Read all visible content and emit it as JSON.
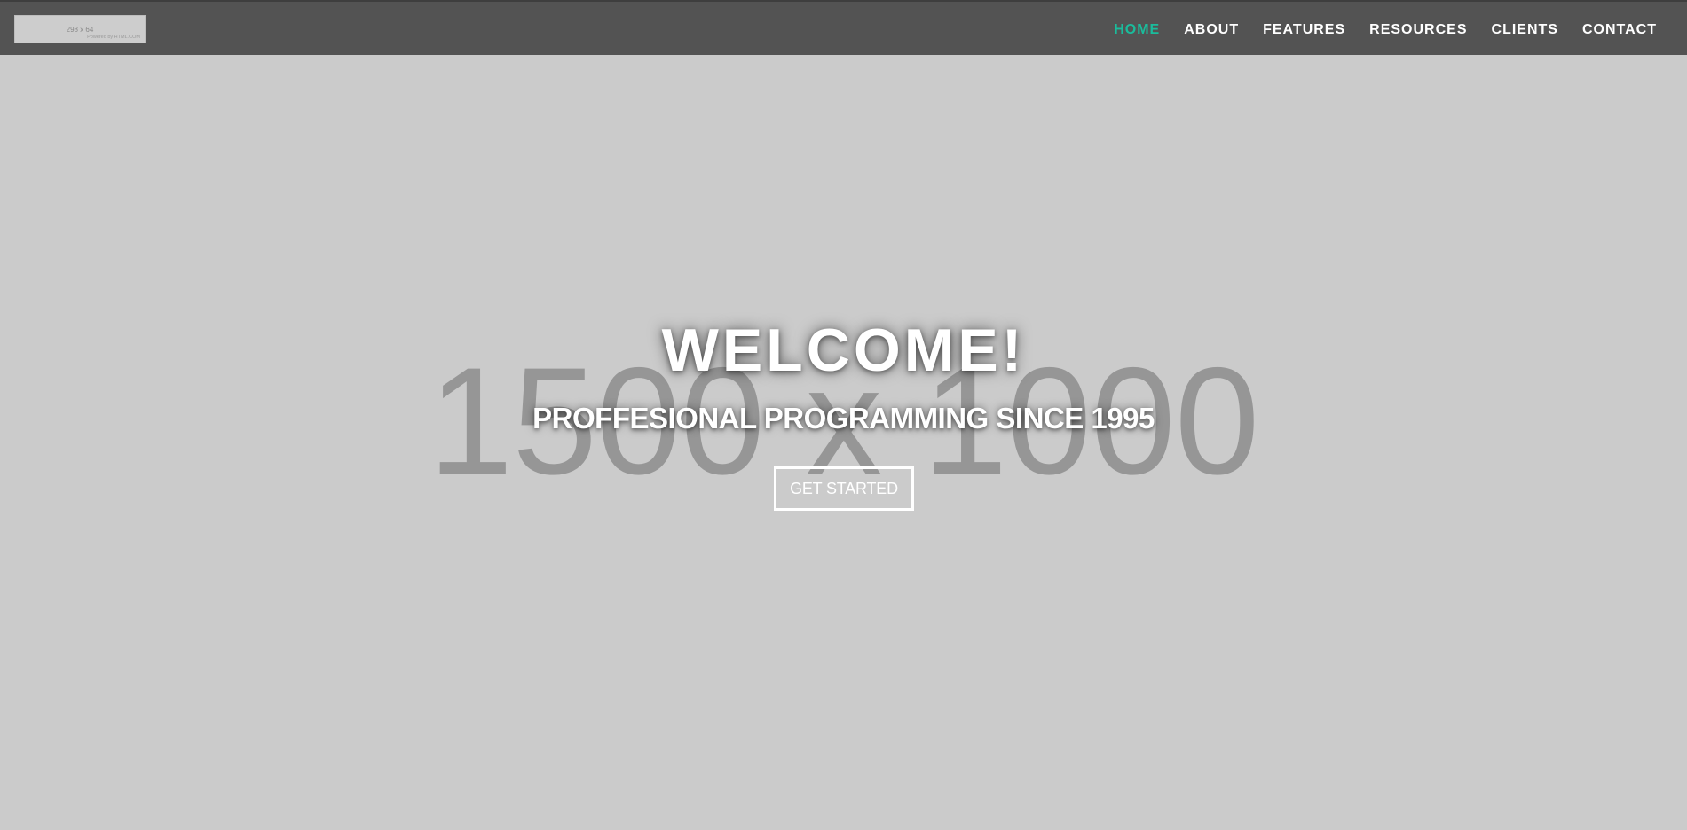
{
  "navbar": {
    "logo": {
      "dimensions_text": "298 x 64",
      "credit_text": "Powered by HTML.COM"
    },
    "items": [
      {
        "label": "HOME",
        "active": true
      },
      {
        "label": "ABOUT",
        "active": false
      },
      {
        "label": "FEATURES",
        "active": false
      },
      {
        "label": "RESOURCES",
        "active": false
      },
      {
        "label": "CLIENTS",
        "active": false
      },
      {
        "label": "CONTACT",
        "active": false
      }
    ],
    "active_color": "#1abc9c",
    "background_color": "#535353"
  },
  "hero": {
    "background_placeholder_text": "1500 x 1000",
    "title": "WELCOME!",
    "subtitle": "PROFFESIONAL PROGRAMMING SINCE 1995",
    "cta_label": "GET STARTED",
    "background_color": "#cbcbcb"
  }
}
